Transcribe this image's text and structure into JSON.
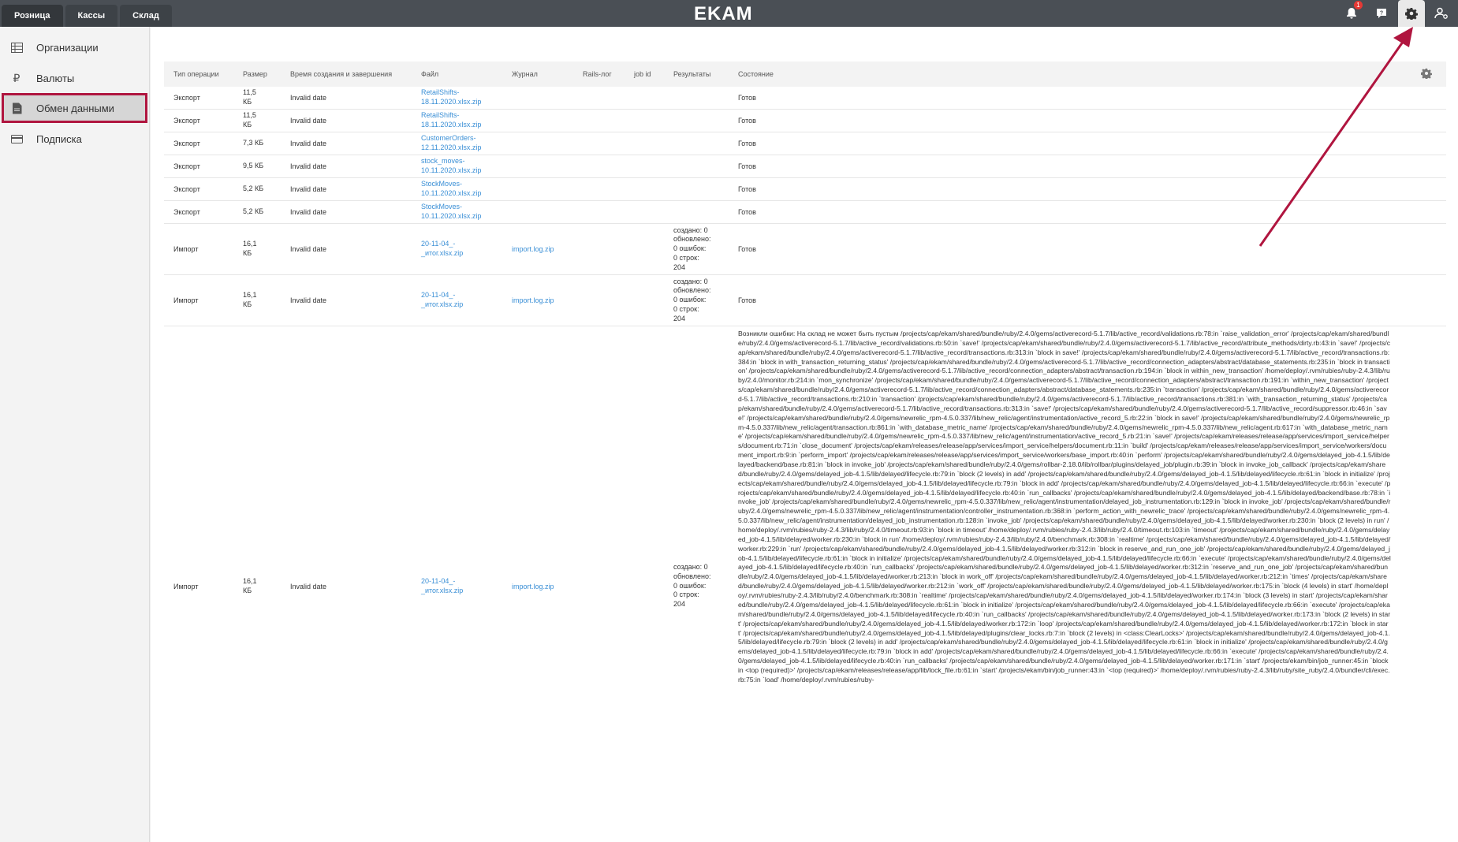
{
  "topbar": {
    "tabs": [
      "Розница",
      "Кассы",
      "Склад"
    ],
    "logo": "EKAM",
    "notifications_count": "1",
    "icons": [
      "bell-icon",
      "help-chat-icon",
      "gear-icon",
      "user-settings-icon"
    ]
  },
  "sidebar": {
    "items": [
      {
        "label": "Организации",
        "icon": "table-grid-icon"
      },
      {
        "label": "Валюты",
        "icon": "ruble-icon"
      },
      {
        "label": "Обмен данными",
        "icon": "file-exchange-icon",
        "active": true
      },
      {
        "label": "Подписка",
        "icon": "card-icon"
      }
    ]
  },
  "table": {
    "headers": [
      "Тип операции",
      "Размер",
      "Время создания и завершения",
      "Файл",
      "Журнал",
      "Rails-лог",
      "job id",
      "Результаты",
      "Состояние"
    ],
    "rows": [
      {
        "type": "Экспорт",
        "size": "11,5\nКБ",
        "time": "Invalid date",
        "file": "RetailShifts-\n18.11.2020.xlsx.zip",
        "log": "",
        "rails": "",
        "job": "",
        "results": "",
        "state": "Готов"
      },
      {
        "type": "Экспорт",
        "size": "11,5\nКБ",
        "time": "Invalid date",
        "file": "RetailShifts-\n18.11.2020.xlsx.zip",
        "log": "",
        "rails": "",
        "job": "",
        "results": "",
        "state": "Готов"
      },
      {
        "type": "Экспорт",
        "size": "7,3 КБ",
        "time": "Invalid date",
        "file": "CustomerOrders-\n12.11.2020.xlsx.zip",
        "log": "",
        "rails": "",
        "job": "",
        "results": "",
        "state": "Готов"
      },
      {
        "type": "Экспорт",
        "size": "9,5 КБ",
        "time": "Invalid date",
        "file": "stock_moves-\n10.11.2020.xlsx.zip",
        "log": "",
        "rails": "",
        "job": "",
        "results": "",
        "state": "Готов"
      },
      {
        "type": "Экспорт",
        "size": "5,2 КБ",
        "time": "Invalid date",
        "file": "StockMoves-\n10.11.2020.xlsx.zip",
        "log": "",
        "rails": "",
        "job": "",
        "results": "",
        "state": "Готов"
      },
      {
        "type": "Экспорт",
        "size": "5,2 КБ",
        "time": "Invalid date",
        "file": "StockMoves-\n10.11.2020.xlsx.zip",
        "log": "",
        "rails": "",
        "job": "",
        "results": "",
        "state": "Готов"
      },
      {
        "type": "Импорт",
        "size": "16,1\nКБ",
        "time": "Invalid date",
        "file": "20-11-04_-\n_итог.xlsx.zip",
        "log": "import.log.zip",
        "rails": "",
        "job": "",
        "results": "создано: 0\nобновлено:\n0 ошибок:\n0 строк:\n204",
        "state": "Готов"
      },
      {
        "type": "Импорт",
        "size": "16,1\nКБ",
        "time": "Invalid date",
        "file": "20-11-04_-\n_итог.xlsx.zip",
        "log": "import.log.zip",
        "rails": "",
        "job": "",
        "results": "создано: 0\nобновлено:\n0 ошибок:\n0 строк:\n204",
        "state": "Готов"
      },
      {
        "type": "Импорт",
        "size": "16,1\nКБ",
        "time": "Invalid date",
        "file": "20-11-04_-\n_итог.xlsx.zip",
        "log": "import.log.zip",
        "rails": "",
        "job": "",
        "results": "создано: 0\nобновлено:\n0 ошибок:\n0 строк:\n204",
        "state": "Возникли ошибки: На склад не может быть пустым /projects/cap/ekam/shared/bundle/ruby/2.4.0/gems/activerecord-5.1.7/lib/active_record/validations.rb:78:in `raise_validation_error' /projects/cap/ekam/shared/bundle/ruby/2.4.0/gems/activerecord-5.1.7/lib/active_record/validations.rb:50:in `save!' /projects/cap/ekam/shared/bundle/ruby/2.4.0/gems/activerecord-5.1.7/lib/active_record/attribute_methods/dirty.rb:43:in `save!' /projects/cap/ekam/shared/bundle/ruby/2.4.0/gems/activerecord-5.1.7/lib/active_record/transactions.rb:313:in `block in save!' /projects/cap/ekam/shared/bundle/ruby/2.4.0/gems/activerecord-5.1.7/lib/active_record/transactions.rb:384:in `block in with_transaction_returning_status' /projects/cap/ekam/shared/bundle/ruby/2.4.0/gems/activerecord-5.1.7/lib/active_record/connection_adapters/abstract/database_statements.rb:235:in `block in transaction' /projects/cap/ekam/shared/bundle/ruby/2.4.0/gems/activerecord-5.1.7/lib/active_record/connection_adapters/abstract/transaction.rb:194:in `block in within_new_transaction' /home/deploy/.rvm/rubies/ruby-2.4.3/lib/ruby/2.4.0/monitor.rb:214:in `mon_synchronize' /projects/cap/ekam/shared/bundle/ruby/2.4.0/gems/activerecord-5.1.7/lib/active_record/connection_adapters/abstract/transaction.rb:191:in `within_new_transaction' /projects/cap/ekam/shared/bundle/ruby/2.4.0/gems/activerecord-5.1.7/lib/active_record/connection_adapters/abstract/database_statements.rb:235:in `transaction' /projects/cap/ekam/shared/bundle/ruby/2.4.0/gems/activerecord-5.1.7/lib/active_record/transactions.rb:210:in `transaction' /projects/cap/ekam/shared/bundle/ruby/2.4.0/gems/activerecord-5.1.7/lib/active_record/transactions.rb:381:in `with_transaction_returning_status' /projects/cap/ekam/shared/bundle/ruby/2.4.0/gems/activerecord-5.1.7/lib/active_record/transactions.rb:313:in `save!' /projects/cap/ekam/shared/bundle/ruby/2.4.0/gems/activerecord-5.1.7/lib/active_record/suppressor.rb:46:in `save!' /projects/cap/ekam/shared/bundle/ruby/2.4.0/gems/newrelic_rpm-4.5.0.337/lib/new_relic/agent/instrumentation/active_record_5.rb:22:in `block in save!' /projects/cap/ekam/shared/bundle/ruby/2.4.0/gems/newrelic_rpm-4.5.0.337/lib/new_relic/agent/transaction.rb:861:in `with_database_metric_name' /projects/cap/ekam/shared/bundle/ruby/2.4.0/gems/newrelic_rpm-4.5.0.337/lib/new_relic/agent.rb:617:in `with_database_metric_name' /projects/cap/ekam/shared/bundle/ruby/2.4.0/gems/newrelic_rpm-4.5.0.337/lib/new_relic/agent/instrumentation/active_record_5.rb:21:in `save!' /projects/cap/ekam/releases/release/app/services/import_service/helpers/document.rb:71:in `close_document' /projects/cap/ekam/releases/release/app/services/import_service/helpers/document.rb:11:in `build' /projects/cap/ekam/releases/release/app/services/import_service/workers/document_import.rb:9:in `perform_import' /projects/cap/ekam/releases/release/app/services/import_service/workers/base_import.rb:40:in `perform' /projects/cap/ekam/shared/bundle/ruby/2.4.0/gems/delayed_job-4.1.5/lib/delayed/backend/base.rb:81:in `block in invoke_job' /projects/cap/ekam/shared/bundle/ruby/2.4.0/gems/rollbar-2.18.0/lib/rollbar/plugins/delayed_job/plugin.rb:39:in `block in invoke_job_callback' /projects/cap/ekam/shared/bundle/ruby/2.4.0/gems/delayed_job-4.1.5/lib/delayed/lifecycle.rb:79:in `block (2 levels) in add' /projects/cap/ekam/shared/bundle/ruby/2.4.0/gems/delayed_job-4.1.5/lib/delayed/lifecycle.rb:61:in `block in initialize' /projects/cap/ekam/shared/bundle/ruby/2.4.0/gems/delayed_job-4.1.5/lib/delayed/lifecycle.rb:79:in `block in add' /projects/cap/ekam/shared/bundle/ruby/2.4.0/gems/delayed_job-4.1.5/lib/delayed/lifecycle.rb:66:in `execute' /projects/cap/ekam/shared/bundle/ruby/2.4.0/gems/delayed_job-4.1.5/lib/delayed/lifecycle.rb:40:in `run_callbacks' /projects/cap/ekam/shared/bundle/ruby/2.4.0/gems/delayed_job-4.1.5/lib/delayed/backend/base.rb:78:in `invoke_job' /projects/cap/ekam/shared/bundle/ruby/2.4.0/gems/newrelic_rpm-4.5.0.337/lib/new_relic/agent/instrumentation/delayed_job_instrumentation.rb:129:in `block in invoke_job' /projects/cap/ekam/shared/bundle/ruby/2.4.0/gems/newrelic_rpm-4.5.0.337/lib/new_relic/agent/instrumentation/controller_instrumentation.rb:368:in `perform_action_with_newrelic_trace' /projects/cap/ekam/shared/bundle/ruby/2.4.0/gems/newrelic_rpm-4.5.0.337/lib/new_relic/agent/instrumentation/delayed_job_instrumentation.rb:128:in `invoke_job' /projects/cap/ekam/shared/bundle/ruby/2.4.0/gems/delayed_job-4.1.5/lib/delayed/worker.rb:230:in `block (2 levels) in run' /home/deploy/.rvm/rubies/ruby-2.4.3/lib/ruby/2.4.0/timeout.rb:93:in `block in timeout' /home/deploy/.rvm/rubies/ruby-2.4.3/lib/ruby/2.4.0/timeout.rb:103:in `timeout' /projects/cap/ekam/shared/bundle/ruby/2.4.0/gems/delayed_job-4.1.5/lib/delayed/worker.rb:230:in `block in run' /home/deploy/.rvm/rubies/ruby-2.4.3/lib/ruby/2.4.0/benchmark.rb:308:in `realtime' /projects/cap/ekam/shared/bundle/ruby/2.4.0/gems/delayed_job-4.1.5/lib/delayed/worker.rb:229:in `run' /projects/cap/ekam/shared/bundle/ruby/2.4.0/gems/delayed_job-4.1.5/lib/delayed/worker.rb:312:in `block in reserve_and_run_one_job' /projects/cap/ekam/shared/bundle/ruby/2.4.0/gems/delayed_job-4.1.5/lib/delayed/lifecycle.rb:61:in `block in initialize' /projects/cap/ekam/shared/bundle/ruby/2.4.0/gems/delayed_job-4.1.5/lib/delayed/lifecycle.rb:66:in `execute' /projects/cap/ekam/shared/bundle/ruby/2.4.0/gems/delayed_job-4.1.5/lib/delayed/lifecycle.rb:40:in `run_callbacks' /projects/cap/ekam/shared/bundle/ruby/2.4.0/gems/delayed_job-4.1.5/lib/delayed/worker.rb:312:in `reserve_and_run_one_job' /projects/cap/ekam/shared/bundle/ruby/2.4.0/gems/delayed_job-4.1.5/lib/delayed/worker.rb:213:in `block in work_off' /projects/cap/ekam/shared/bundle/ruby/2.4.0/gems/delayed_job-4.1.5/lib/delayed/worker.rb:212:in `times' /projects/cap/ekam/shared/bundle/ruby/2.4.0/gems/delayed_job-4.1.5/lib/delayed/worker.rb:212:in `work_off' /projects/cap/ekam/shared/bundle/ruby/2.4.0/gems/delayed_job-4.1.5/lib/delayed/worker.rb:175:in `block (4 levels) in start' /home/deploy/.rvm/rubies/ruby-2.4.3/lib/ruby/2.4.0/benchmark.rb:308:in `realtime' /projects/cap/ekam/shared/bundle/ruby/2.4.0/gems/delayed_job-4.1.5/lib/delayed/worker.rb:174:in `block (3 levels) in start' /projects/cap/ekam/shared/bundle/ruby/2.4.0/gems/delayed_job-4.1.5/lib/delayed/lifecycle.rb:61:in `block in initialize' /projects/cap/ekam/shared/bundle/ruby/2.4.0/gems/delayed_job-4.1.5/lib/delayed/lifecycle.rb:66:in `execute' /projects/cap/ekam/shared/bundle/ruby/2.4.0/gems/delayed_job-4.1.5/lib/delayed/lifecycle.rb:40:in `run_callbacks' /projects/cap/ekam/shared/bundle/ruby/2.4.0/gems/delayed_job-4.1.5/lib/delayed/worker.rb:173:in `block (2 levels) in start' /projects/cap/ekam/shared/bundle/ruby/2.4.0/gems/delayed_job-4.1.5/lib/delayed/worker.rb:172:in `loop' /projects/cap/ekam/shared/bundle/ruby/2.4.0/gems/delayed_job-4.1.5/lib/delayed/worker.rb:172:in `block in start' /projects/cap/ekam/shared/bundle/ruby/2.4.0/gems/delayed_job-4.1.5/lib/delayed/plugins/clear_locks.rb:7:in `block (2 levels) in <class:ClearLocks>' /projects/cap/ekam/shared/bundle/ruby/2.4.0/gems/delayed_job-4.1.5/lib/delayed/lifecycle.rb:79:in `block (2 levels) in add' /projects/cap/ekam/shared/bundle/ruby/2.4.0/gems/delayed_job-4.1.5/lib/delayed/lifecycle.rb:61:in `block in initialize' /projects/cap/ekam/shared/bundle/ruby/2.4.0/gems/delayed_job-4.1.5/lib/delayed/lifecycle.rb:79:in `block in add' /projects/cap/ekam/shared/bundle/ruby/2.4.0/gems/delayed_job-4.1.5/lib/delayed/lifecycle.rb:66:in `execute' /projects/cap/ekam/shared/bundle/ruby/2.4.0/gems/delayed_job-4.1.5/lib/delayed/lifecycle.rb:40:in `run_callbacks' /projects/cap/ekam/shared/bundle/ruby/2.4.0/gems/delayed_job-4.1.5/lib/delayed/worker.rb:171:in `start' /projects/ekam/bin/job_runner:45:in `block in <top (required)>' /projects/cap/ekam/releases/release/app/lib/lock_file.rb:61:in `start' /projects/ekam/bin/job_runner:43:in `<top (required)>' /home/deploy/.rvm/rubies/ruby-2.4.3/lib/ruby/site_ruby/2.4.0/bundler/cli/exec.rb:75:in `load' /home/deploy/.rvm/rubies/ruby-"
      }
    ]
  },
  "colors": {
    "topbar": "#4a4f55",
    "link": "#3a8fd6",
    "annotation": "#b0153f"
  }
}
